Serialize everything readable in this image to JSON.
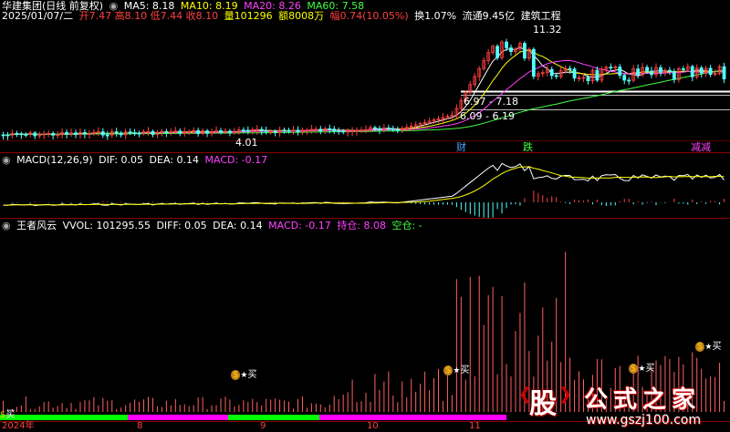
{
  "price_panel": {
    "stock_name": "华建集团(日线 前复权)",
    "ma5": "MA5: 8.18",
    "ma10": "MA10: 8.19",
    "ma20": "MA20: 8.26",
    "ma60": "MA60: 7.58",
    "date": "2025/01/07/二",
    "open": "开7.47",
    "high": "高8.10",
    "low": "低7.44",
    "close": "收8.10",
    "volume": "量101296",
    "amount": "额8008万",
    "change": "幅0.74(10.05%)",
    "turnover": "换1.07%",
    "float_cap": "流通9.45亿",
    "industry": "建筑工程",
    "label_high": "11.32",
    "label_low": "4.01",
    "range1": "6.97 - 7.18",
    "range2": "6.09 - 6.19",
    "tag_cai": "财",
    "tag_die": "跌",
    "tag_jianchi": "减减"
  },
  "macd_panel": {
    "title": "MACD(12,26,9)",
    "dif": "DIF: 0.05",
    "dea": "DEA: 0.14",
    "macd": "MACD: -0.17"
  },
  "vol_panel": {
    "title": "王者风云",
    "vvol": "VVOL: 101295.55",
    "diff": "DIFF: 0.05",
    "dea": "DEA: 0.14",
    "macd": "MACD: -0.17",
    "hold": "持仓: 8.08",
    "empty": "空仓: -",
    "buy_label": "买",
    "buy_bag": "$"
  },
  "x_axis": {
    "labels": [
      "2024年",
      "8",
      "9",
      "10",
      "11"
    ]
  },
  "watermark": {
    "logo_char": "股",
    "text": "公式之家",
    "url": "www.gszj100.com"
  },
  "colors": {
    "up": "#ff4040",
    "down": "#54ffff",
    "ma5": "#ffffff",
    "ma10": "#ffff00",
    "ma20": "#ff40ff",
    "ma60": "#40ff40",
    "separator": "#8b0000",
    "hold_bar": "#ff00ff",
    "empty_bar": "#00ff00"
  }
}
